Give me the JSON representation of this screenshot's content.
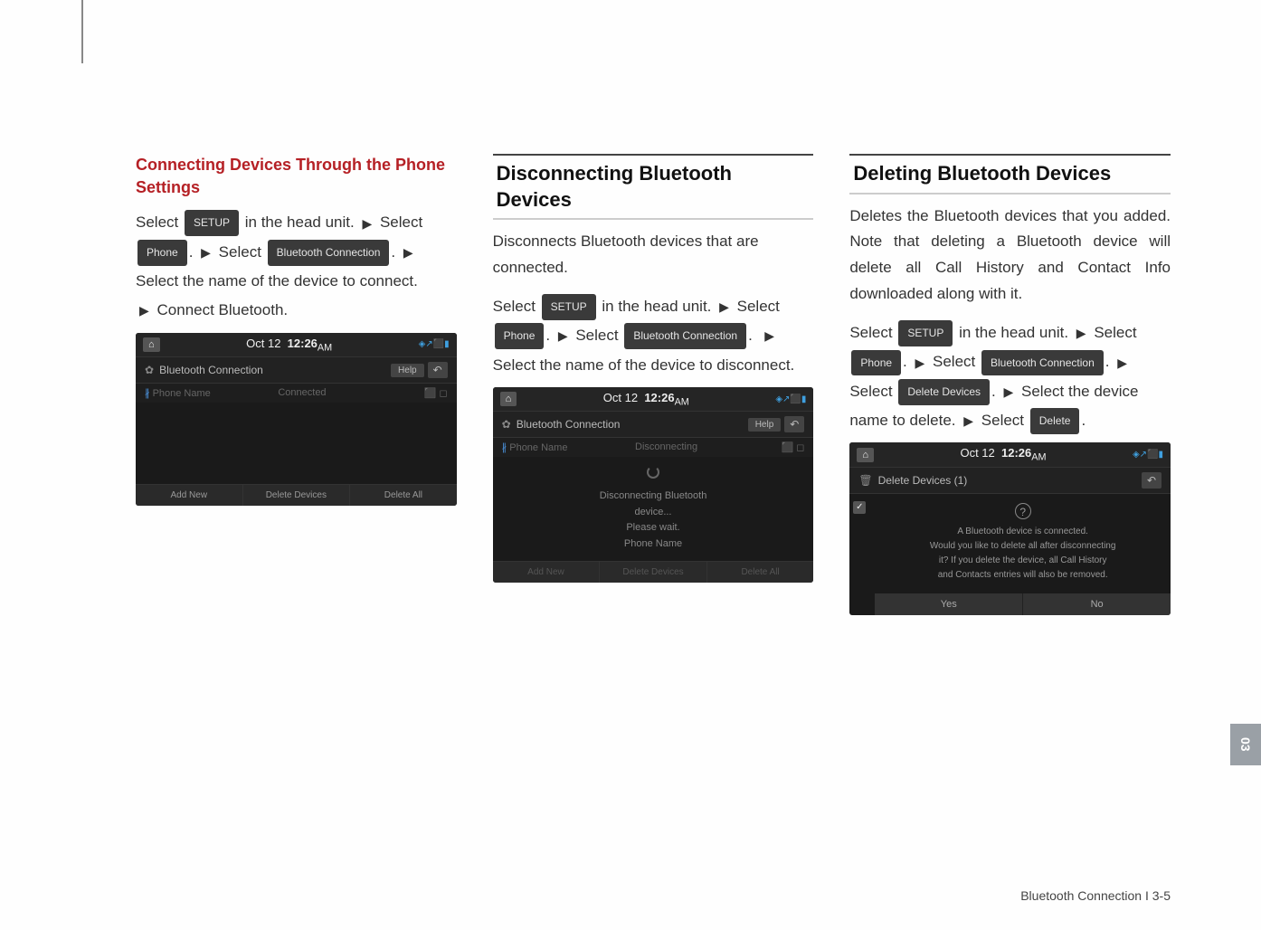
{
  "col1": {
    "title": "Connecting Devices Through the Phone Settings",
    "instr_select": "Select ",
    "btn_setup": "SETUP",
    "in_head_unit": " in the head unit. ",
    "select_word": " Select ",
    "btn_phone": "Phone",
    "btn_bt_conn": "Bluetooth Connection",
    "instr_name": "Select the name of the device to connect.",
    "connect_bt": " Connect Bluetooth.",
    "shot": {
      "date": "Oct 12",
      "time": "12:26",
      "ampm": "AM",
      "status": "◈↗⬛▮",
      "header_title": "Bluetooth Connection",
      "help": "Help",
      "back": "↶",
      "col_name": "Phone Name",
      "col_status": "Connected",
      "col_icons": "⬛ ◻",
      "bt_icon": "∦",
      "footer1": "Add New",
      "footer2": "Delete Devices",
      "footer3": "Delete All"
    }
  },
  "col2": {
    "title": "Disconnecting Bluetooth Devices",
    "intro": "Disconnects Bluetooth devices that are connected.",
    "instr_select": "Select ",
    "btn_setup": "SETUP",
    "in_head_unit": " in the head unit.  ",
    "select_word": " Select ",
    "btn_phone": "Phone",
    "btn_bt_conn": "Bluetooth Connection",
    "instr_name": "Select the name of the device to disconnect.",
    "shot": {
      "date": "Oct 12",
      "time": "12:26",
      "ampm": "AM",
      "status": "◈↗⬛▮",
      "header_title": "Bluetooth Connection",
      "help": "Help",
      "back": "↶",
      "col_name": "Phone Name",
      "col_status": "Disconnecting",
      "col_icons": "⬛ ◻",
      "bt_icon": "∦",
      "msg1": "Disconnecting Bluetooth",
      "msg2": "device...",
      "msg3": "Please wait.",
      "msg4": "Phone Name",
      "footer1": "Add New",
      "footer2": "Delete Devices",
      "footer3": "Delete All"
    }
  },
  "col3": {
    "title": "Deleting Bluetooth Devices",
    "intro": "Deletes the Bluetooth devices that you added. Note that deleting a Bluetooth device will delete all Call History and Contact Info downloaded along with it.",
    "instr_select": "Select ",
    "btn_setup": "SETUP",
    "in_head_unit": " in the head unit.  ",
    "select_word": " Select ",
    "btn_phone": "Phone",
    "btn_bt_conn": "Bluetooth Connection",
    "btn_delete_devices": "Delete Devices",
    "instr_select_device": " Select the device name to delete. ",
    "btn_delete": "Delete",
    "shot": {
      "date": "Oct 12",
      "time": "12:26",
      "ampm": "AM",
      "status": "◈↗⬛▮",
      "header_title": "Delete Devices (1)",
      "back": "↶",
      "dialog_l1": "A Bluetooth device is connected.",
      "dialog_l2": "Would you like to delete all after disconnecting",
      "dialog_l3": "it? If you delete the device, all Call History",
      "dialog_l4": "and Contacts entries will also be removed.",
      "yes": "Yes",
      "no": "No"
    }
  },
  "side_tab": "03",
  "footer": "Bluetooth Connection I 3-5"
}
